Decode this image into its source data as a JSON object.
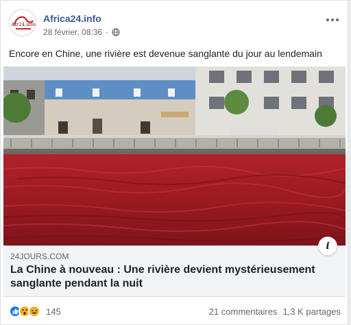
{
  "post": {
    "page_name": "Africa24.info",
    "date": "28 février, 08:36",
    "text": "Encore en Chine, une rivière est devenue sanglante du jour au lendemain"
  },
  "avatar": {
    "logo_text": "Afr24.info",
    "brand_color": "#c2262e"
  },
  "link": {
    "domain": "24JOURS.COM",
    "title": "La Chine à nouveau : Une rivière devient mystérieusement sanglante pendant la nuit",
    "info_glyph": "i"
  },
  "footer": {
    "reaction_count": "145",
    "comments": "21 commentaires",
    "shares": "1,3 K partages"
  },
  "colors": {
    "link_blue": "#385898",
    "like_blue": "#1877f2",
    "reaction_yellow": "#f7b125",
    "river_red": "#9c1a22"
  }
}
